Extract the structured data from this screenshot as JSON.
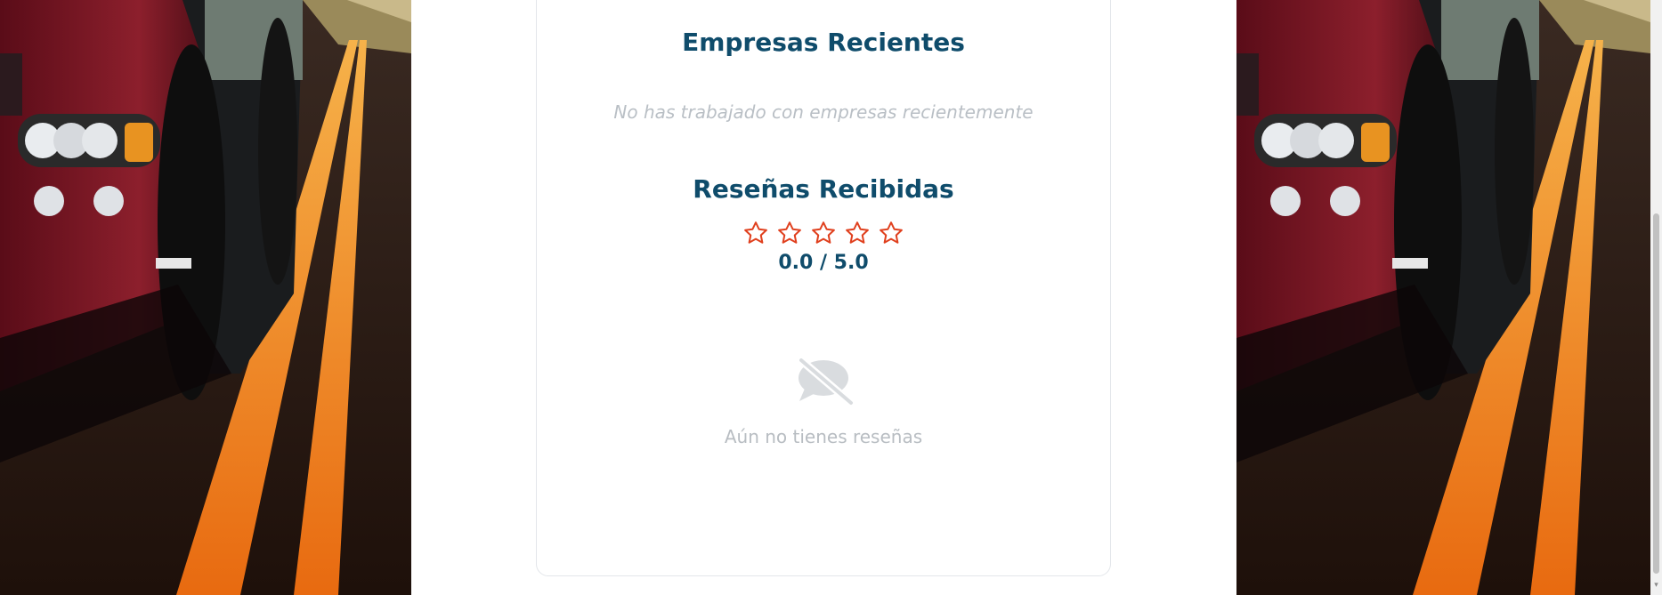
{
  "companies": {
    "title": "Empresas Recientes",
    "empty_message": "No has trabajado con empresas recientemente"
  },
  "reviews": {
    "title": "Reseñas Recibidas",
    "rating_text": "0.0 / 5.0",
    "rating": 0.0,
    "max_rating": 5,
    "star_color": "#e0401e",
    "empty_icon": "comment-slash-icon",
    "empty_message": "Aún no tienes reseñas"
  },
  "colors": {
    "title": "#0f4c6b",
    "muted": "#b9bfc5",
    "star": "#e0401e"
  },
  "icons": {
    "star": "star-outline-icon",
    "scroll_down": "chevron-down-icon"
  }
}
